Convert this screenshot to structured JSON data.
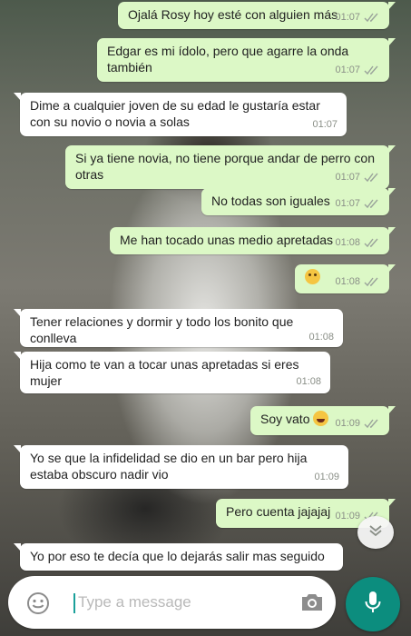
{
  "messages": [
    {
      "direction": "out",
      "text": "Ojalá Rosy hoy esté con alguien más",
      "time": "01:07",
      "status": "read"
    },
    {
      "direction": "out",
      "text": "Edgar es mi ídolo, pero que agarre la onda también",
      "time": "01:07",
      "status": "read"
    },
    {
      "direction": "in",
      "text": "Dime a cualquier joven de su edad le gustaría estar con su novio o novia a solas",
      "time": "01:07"
    },
    {
      "direction": "out",
      "text": "Si ya tiene novia, no tiene porque andar de perro con otras",
      "time": "01:07",
      "status": "read"
    },
    {
      "direction": "out",
      "text": "No todas son iguales",
      "time": "01:07",
      "status": "read"
    },
    {
      "direction": "out",
      "text": "Me han tocado unas medio apretadas",
      "time": "01:08",
      "status": "read"
    },
    {
      "direction": "out",
      "text": "",
      "emoji": "thinking-face",
      "time": "01:08",
      "status": "read"
    },
    {
      "direction": "in",
      "text": "Tener relaciones y dormir y todo los bonito que conlleva",
      "time": "01:08"
    },
    {
      "direction": "in",
      "text": "Hija como te van a tocar unas apretadas si eres mujer",
      "time": "01:08"
    },
    {
      "direction": "out",
      "text": "Soy vato",
      "emoji": "laughing-tears-face",
      "time": "01:09",
      "status": "read"
    },
    {
      "direction": "in",
      "text": "Yo se que la infidelidad se dio en un bar pero hija estaba obscuro nadir vio",
      "time": "01:09"
    },
    {
      "direction": "out",
      "text": "Pero cuenta jajajaj",
      "time": "01:09",
      "status": "read"
    },
    {
      "direction": "in",
      "text": "Yo por eso te decía que lo dejarás salir mas seguido",
      "time": ""
    }
  ],
  "composer": {
    "placeholder": "Type a message",
    "emoji_icon": "smiley-icon",
    "camera_icon": "camera-icon"
  },
  "mic_icon": "microphone-icon",
  "scroll_icon": "double-chevron-down-icon",
  "colors": {
    "outgoing_bubble": "#dcf8c6",
    "incoming_bubble": "#ffffff",
    "timestamp": "#8a8f87",
    "mic_button": "#0c8d7e",
    "read_ticks": "#9aa39a"
  }
}
